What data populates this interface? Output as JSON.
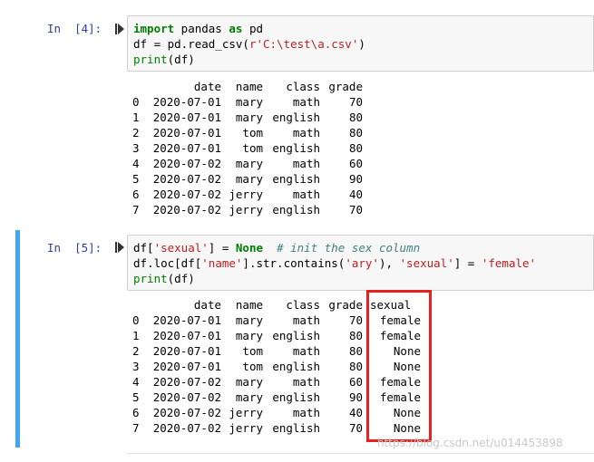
{
  "cells": [
    {
      "prompt": "In  [4]:",
      "code": [
        [
          "import",
          " pandas ",
          "as",
          " pd"
        ],
        [
          "df = pd.read_csv(",
          "r'C:\\test\\a.csv'",
          ")"
        ],
        [
          "print",
          "(df)"
        ]
      ],
      "table": {
        "headers": [
          "",
          "date",
          "name",
          "class",
          "grade"
        ],
        "rows": [
          [
            "0",
            "2020-07-01",
            "mary",
            "math",
            "70"
          ],
          [
            "1",
            "2020-07-01",
            "mary",
            "english",
            "80"
          ],
          [
            "2",
            "2020-07-01",
            "tom",
            "math",
            "80"
          ],
          [
            "3",
            "2020-07-01",
            "tom",
            "english",
            "80"
          ],
          [
            "4",
            "2020-07-02",
            "mary",
            "math",
            "60"
          ],
          [
            "5",
            "2020-07-02",
            "mary",
            "english",
            "90"
          ],
          [
            "6",
            "2020-07-02",
            "jerry",
            "math",
            "40"
          ],
          [
            "7",
            "2020-07-02",
            "jerry",
            "english",
            "70"
          ]
        ]
      }
    },
    {
      "prompt": "In  [5]:",
      "code": [
        [
          "df[",
          "'sexual'",
          "] = ",
          "None",
          "  ",
          "# init the sex column"
        ],
        [
          "df.loc[df[",
          "'name'",
          "].str.contains(",
          "'ary'",
          "), ",
          "'sexual'",
          "] = ",
          "'female'"
        ],
        [
          "print",
          "(df)"
        ]
      ],
      "table": {
        "headers": [
          "",
          "date",
          "name",
          "class",
          "grade",
          "sexual"
        ],
        "rows": [
          [
            "0",
            "2020-07-01",
            "mary",
            "math",
            "70",
            "female"
          ],
          [
            "1",
            "2020-07-01",
            "mary",
            "english",
            "80",
            "female"
          ],
          [
            "2",
            "2020-07-01",
            "tom",
            "math",
            "80",
            "None"
          ],
          [
            "3",
            "2020-07-01",
            "tom",
            "english",
            "80",
            "None"
          ],
          [
            "4",
            "2020-07-02",
            "mary",
            "math",
            "60",
            "female"
          ],
          [
            "5",
            "2020-07-02",
            "mary",
            "english",
            "90",
            "female"
          ],
          [
            "6",
            "2020-07-02",
            "jerry",
            "math",
            "40",
            "None"
          ],
          [
            "7",
            "2020-07-02",
            "jerry",
            "english",
            "70",
            "None"
          ]
        ]
      }
    }
  ],
  "watermark": "https://blog.csdn.net/u014453898",
  "colors": {
    "selected_border": "#42a5f5",
    "highlight_box": "#e8201f",
    "prompt": "#303f9f"
  },
  "icons": {
    "run": "run-cell-icon"
  }
}
